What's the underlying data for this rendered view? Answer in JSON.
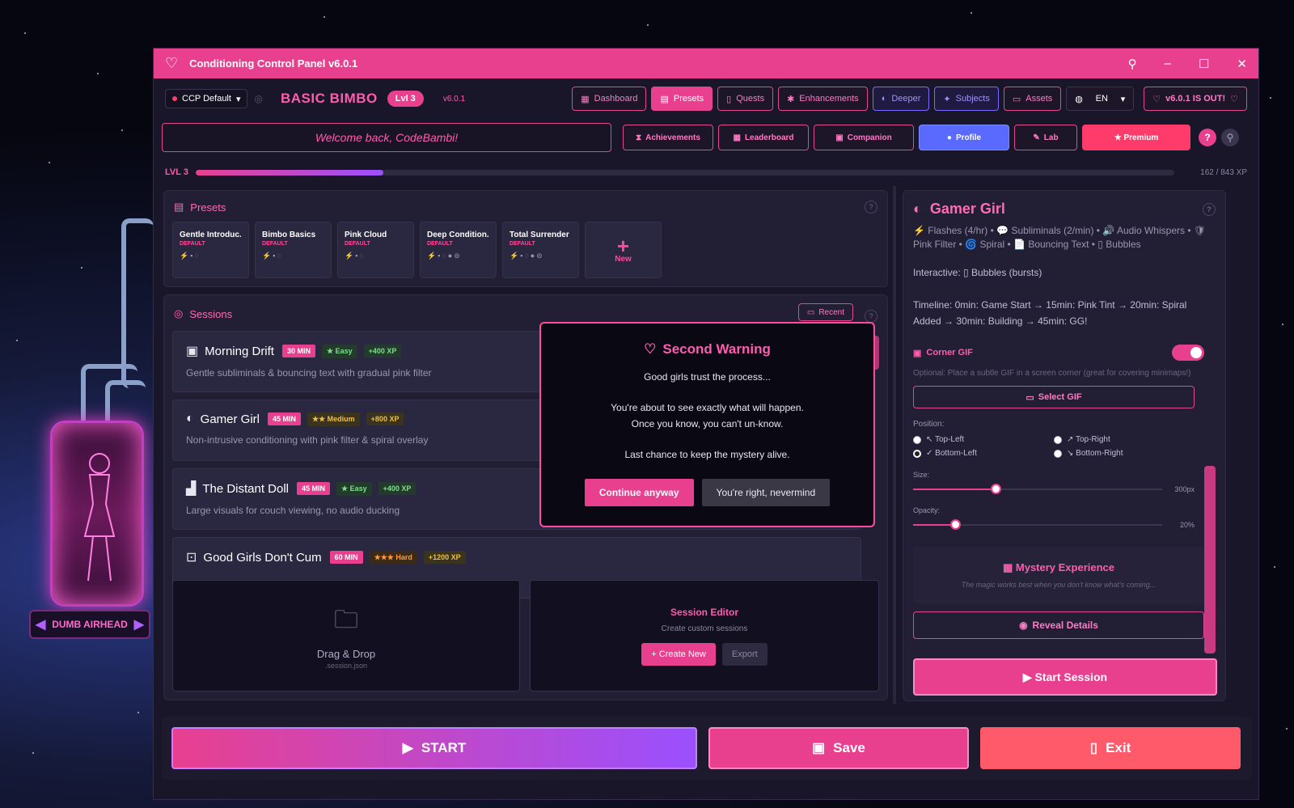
{
  "window": {
    "title": "Conditioning Control Panel v6.0.1"
  },
  "topbar": {
    "profile": "CCP Default",
    "brand": "BASIC BIMBO",
    "level_pill": "Lvl 3",
    "version": "v6.0.1",
    "nav": [
      "Dashboard",
      "Presets",
      "Quests",
      "Enhancements",
      "Deeper",
      "Subjects",
      "Assets"
    ],
    "language": "EN",
    "update_banner": "v6.0.1 IS OUT!"
  },
  "row2": {
    "welcome": "Welcome back, CodeBambi!",
    "buttons": [
      "Achievements",
      "Leaderboard",
      "Companion",
      "Profile",
      "Lab",
      "★ Premium"
    ]
  },
  "xp": {
    "label": "LVL 3",
    "value": "162 / 843 XP",
    "progress": 0.192
  },
  "presets": {
    "title": "Presets",
    "cards": [
      {
        "name": "Gentle Introduc...",
        "tag": "DEFAULT"
      },
      {
        "name": "Bimbo Basics",
        "tag": "DEFAULT"
      },
      {
        "name": "Pink Cloud",
        "tag": "DEFAULT"
      },
      {
        "name": "Deep Condition...",
        "tag": "DEFAULT"
      },
      {
        "name": "Total Surrender",
        "tag": "DEFAULT"
      }
    ],
    "new_label": "New"
  },
  "sessions": {
    "title": "Sessions",
    "recent": "Recent",
    "items": [
      {
        "name": "Morning Drift",
        "time": "30 MIN",
        "difficulty": "★ Easy",
        "xp": "+400 XP",
        "desc": "Gentle subliminals & bouncing text with gradual pink filter"
      },
      {
        "name": "Gamer Girl",
        "time": "45 MIN",
        "difficulty": "★★ Medium",
        "xp": "+800 XP",
        "desc": "Non-intrusive conditioning with pink filter & spiral overlay"
      },
      {
        "name": "The Distant Doll",
        "time": "45 MIN",
        "difficulty": "★ Easy",
        "xp": "+400 XP",
        "desc": "Large visuals for couch viewing, no audio ducking"
      },
      {
        "name": "Good Girls Don't Cum",
        "time": "60 MIN",
        "difficulty": "★★★ Hard",
        "xp": "+1200 XP",
        "desc": ""
      }
    ],
    "drop_title": "Drag & Drop",
    "drop_sub": ".session.json",
    "editor_title": "Session Editor",
    "editor_sub": "Create custom sessions",
    "create_new": "+ Create New",
    "export": "Export"
  },
  "detail": {
    "title": "Gamer Girl",
    "features": "⚡ Flashes (4/hr) • 💬 Subliminals (2/min) • 🔊 Audio Whispers • 🛡 Pink Filter • 🌀 Spiral • 📄 Bouncing Text • ▯ Bubbles",
    "interactive": "Interactive: ▯ Bubbles (bursts)",
    "timeline": "Timeline: 0min: Game Start → 15min: Pink Tint → 20min: Spiral Added → 30min: Building → 45min: GG!",
    "corner_gif": "Corner GIF",
    "corner_opt": "Optional: Place a subtle GIF in a screen corner (great for covering minimaps!)",
    "select_gif": "Select GIF",
    "position_label": "Position:",
    "positions": [
      "↖ Top-Left",
      "↗ Top-Right",
      "✓ Bottom-Left",
      "↘ Bottom-Right"
    ],
    "size_label": "Size:",
    "size_value": "300px",
    "size_level": 0.33,
    "opacity_label": "Opacity:",
    "opacity_value": "20%",
    "opacity_level": 0.17,
    "mystery_title": "Mystery Experience",
    "mystery_sub": "The magic works best when you don't know what's coming...",
    "reveal": "Reveal Details",
    "start_session": "▶ Start Session"
  },
  "footer": {
    "start": "START",
    "save": "Save",
    "exit": "Exit"
  },
  "modal": {
    "title": "Second Warning",
    "line1": "Good girls trust the process...",
    "line2": "You're about to see exactly what will happen.",
    "line3": "Once you know, you can't un-know.",
    "line4": "Last chance to keep the mystery alive.",
    "continue": "Continue anyway",
    "cancel": "You're right, nevermind"
  },
  "pod": {
    "label": "DUMB AIRHEAD"
  },
  "colors": {
    "accent": "#e8408f",
    "accent_light": "#ff5cb0",
    "purple": "#9a50ff",
    "blue": "#5a6aff",
    "red": "#ff5a6a"
  }
}
